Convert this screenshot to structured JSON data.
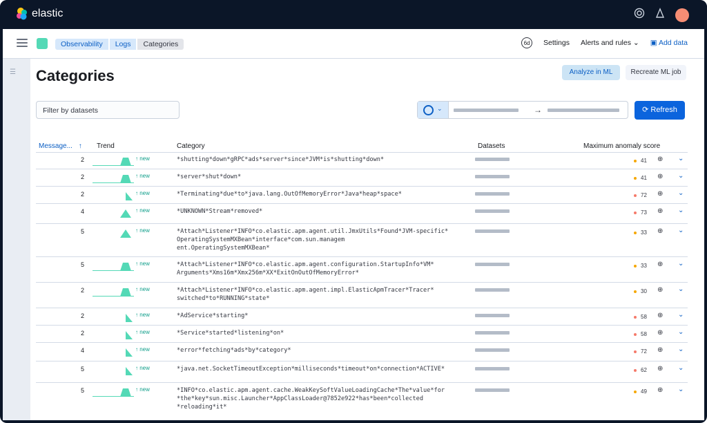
{
  "app": {
    "brand": "elastic"
  },
  "breadcrumbs": [
    "Observability",
    "Logs",
    "Categories"
  ],
  "header_actions": {
    "settings": "Settings",
    "alerts": "Alerts and rules",
    "add_data": "Add data"
  },
  "page": {
    "title": "Categories",
    "analyze_label": "Analyze in ML",
    "recreate_label": "Recreate ML job"
  },
  "filter": {
    "placeholder": "Filter by datasets"
  },
  "refresh_label": "Refresh",
  "columns": {
    "messages": "Message...",
    "trend": "Trend",
    "category": "Category",
    "datasets": "Datasets",
    "score": "Maximum anomaly score"
  },
  "trend_new_label": "new",
  "colors": {
    "yellow": "#f5a700",
    "red": "#f57a6a",
    "teal": "#54d9b6",
    "accent": "#0b64dd"
  },
  "rows": [
    {
      "count": "2",
      "category": "*shutting*down*gRPC*ads*server*since*JVM*is*shutting*down*",
      "score": "41",
      "level": "yellow",
      "trend": "wide"
    },
    {
      "count": "2",
      "category": "*server*shut*down*",
      "score": "41",
      "level": "yellow",
      "trend": "wide"
    },
    {
      "count": "2",
      "category": "*Terminating*due*to*java.lang.OutOfMemoryError*Java*heap*space*",
      "score": "72",
      "level": "red",
      "trend": "spike"
    },
    {
      "count": "4",
      "category": "*UNKNOWN*Stream*removed*",
      "score": "73",
      "level": "red",
      "trend": "peak"
    },
    {
      "count": "5",
      "category": "*Attach*Listener*INFO*co.elastic.apm.agent.util.JmxUtils*Found*JVM-specific*\nOperatingSystemMXBean*interface*com.sun.managem\nent.OperatingSystemMXBean*",
      "score": "33",
      "level": "yellow",
      "trend": "peak"
    },
    {
      "count": "5",
      "category": "*Attach*Listener*INFO*co.elastic.apm.agent.configuration.StartupInfo*VM*\nArguments*Xms16m*Xmx256m*XX*ExitOnOutOfMemoryError*",
      "score": "33",
      "level": "yellow",
      "trend": "wide"
    },
    {
      "count": "2",
      "category": "*Attach*Listener*INFO*co.elastic.apm.agent.impl.ElasticApmTracer*Tracer*\nswitched*to*RUNNING*state*",
      "score": "30",
      "level": "yellow",
      "trend": "wide"
    },
    {
      "count": "2",
      "category": "*AdService*starting*",
      "score": "58",
      "level": "red",
      "trend": "spike"
    },
    {
      "count": "2",
      "category": "*Service*started*listening*on*",
      "score": "58",
      "level": "red",
      "trend": "spike"
    },
    {
      "count": "4",
      "category": "*error*fetching*ads*by*category*",
      "score": "72",
      "level": "red",
      "trend": "spike"
    },
    {
      "count": "5",
      "category": "*java.net.SocketTimeoutException*milliseconds*timeout*on*connection*ACTIVE*",
      "score": "62",
      "level": "red",
      "trend": "spike"
    },
    {
      "count": "5",
      "category": "*INFO*co.elastic.apm.agent.cache.WeakKeySoftValueLoadingCache*The*value*for\n*the*key*sun.misc.Launcher*AppClassLoader@7852e922*has*been*collected\n*reloading*it*",
      "score": "49",
      "level": "yellow",
      "trend": "wide"
    }
  ]
}
